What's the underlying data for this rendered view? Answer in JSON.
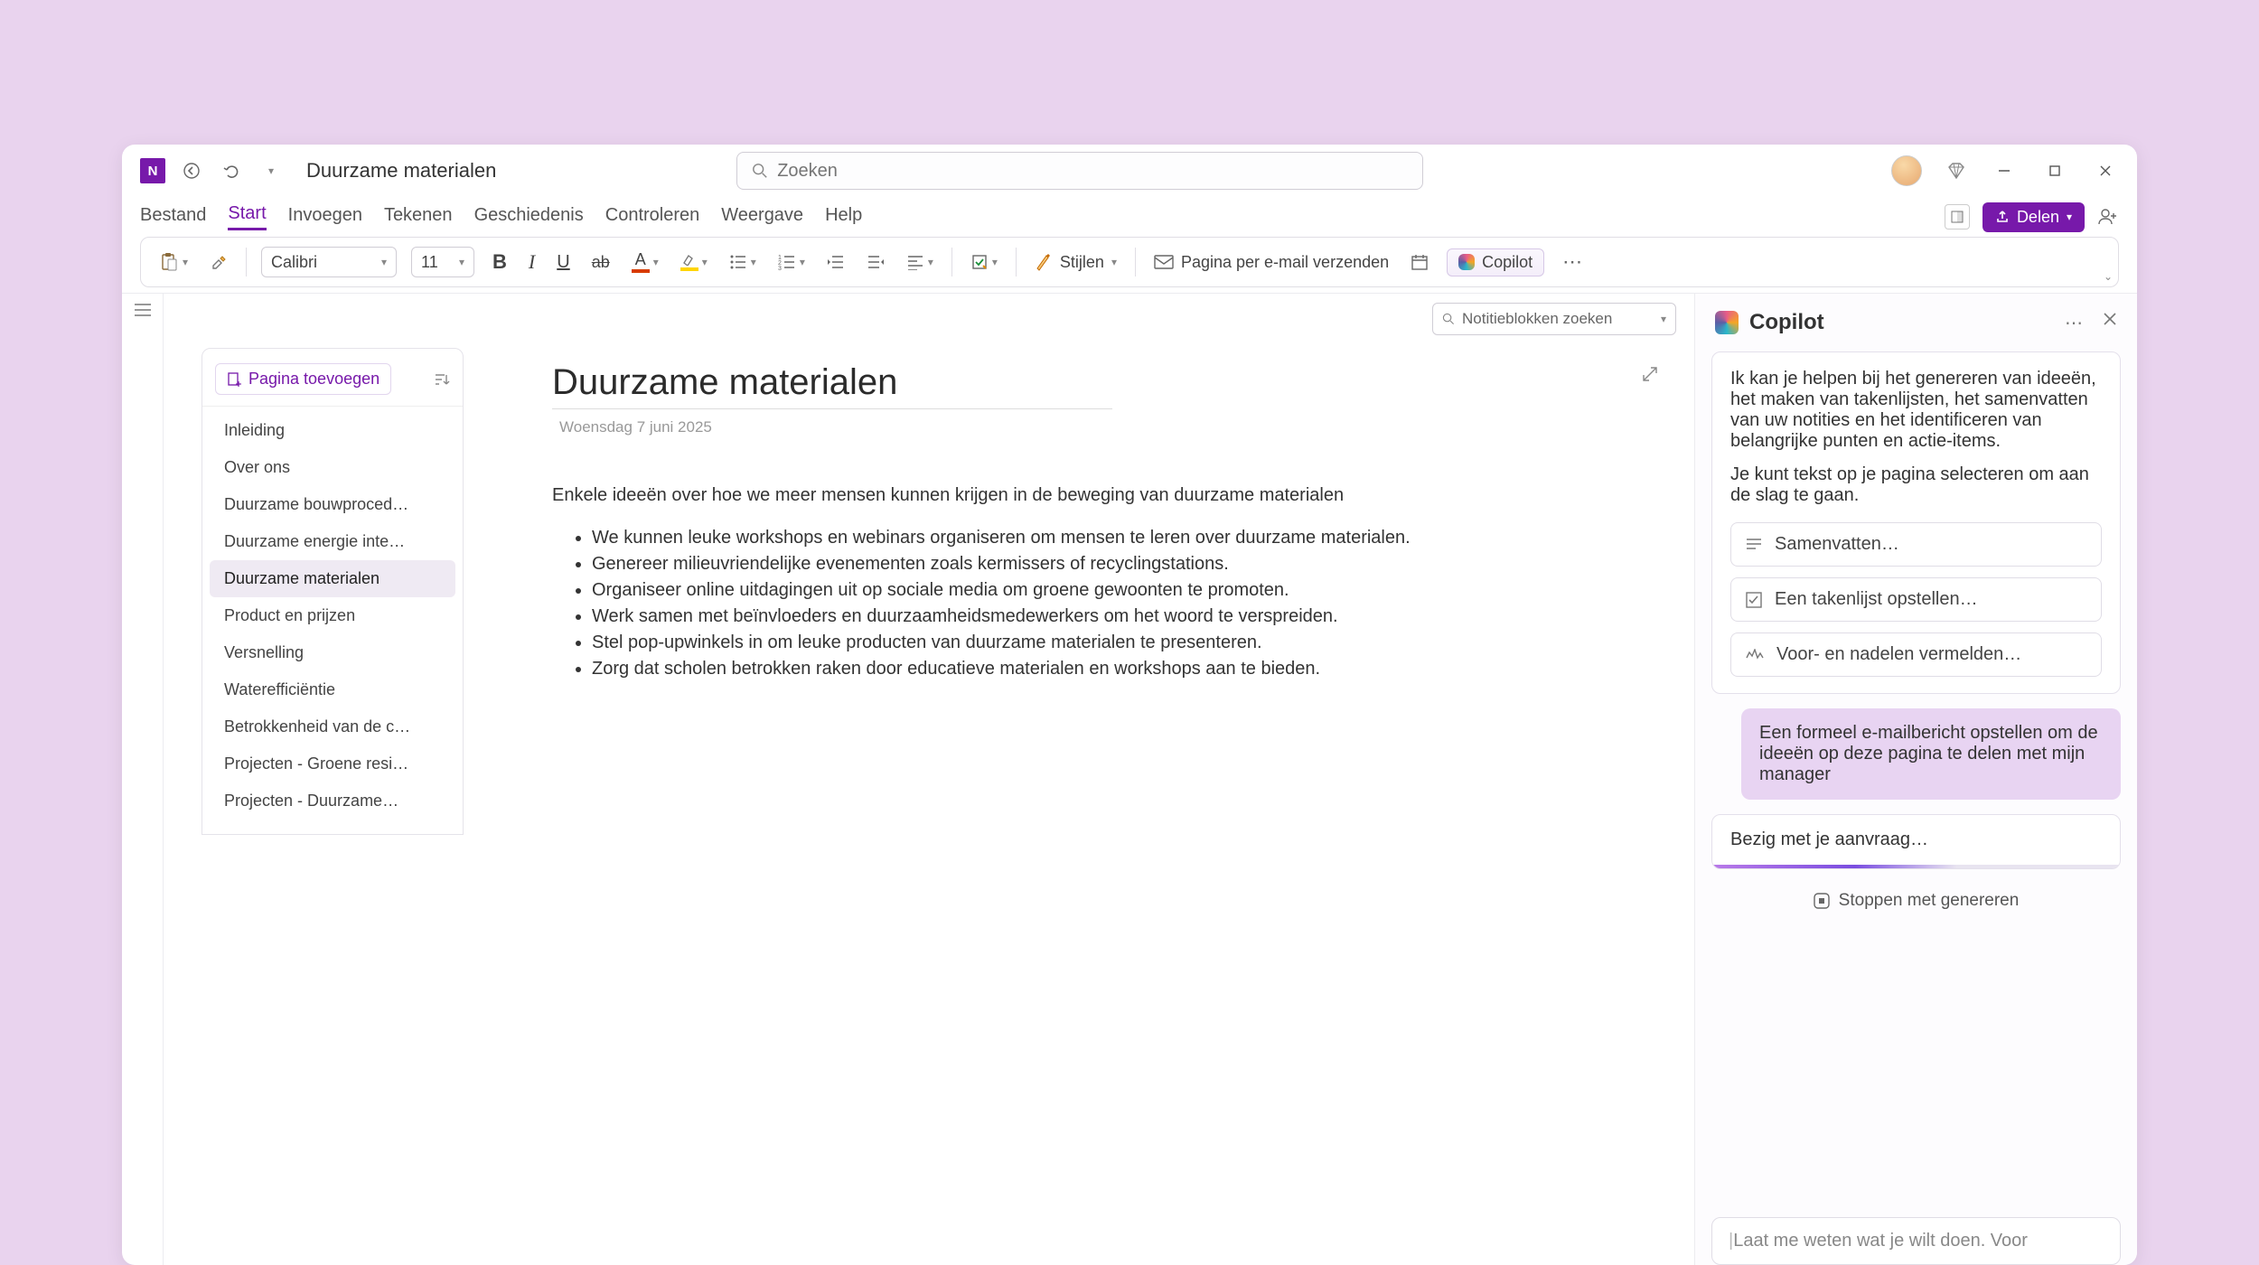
{
  "titlebar": {
    "doc_title": "Duurzame materialen",
    "search_placeholder": "Zoeken"
  },
  "ribbon": {
    "tabs": [
      "Bestand",
      "Start",
      "Invoegen",
      "Tekenen",
      "Geschiedenis",
      "Controleren",
      "Weergave",
      "Help"
    ],
    "active_index": 1,
    "share_label": "Delen"
  },
  "toolbar": {
    "font_name": "Calibri",
    "font_size": "11",
    "styles_label": "Stijlen",
    "email_page_label": "Pagina per e-mail verzenden",
    "copilot_label": "Copilot"
  },
  "notebook_search_placeholder": "Notitieblokken zoeken",
  "page_nav": {
    "add_page_label": "Pagina toevoegen",
    "items": [
      "Inleiding",
      "Over ons",
      "Duurzame bouwproced…",
      "Duurzame energie inte…",
      "Duurzame materialen",
      "Product en prijzen",
      "Versnelling",
      "Waterefficiëntie",
      "Betrokkenheid van de c…",
      "Projecten - Groene resi…",
      "Projecten - Duurzame…"
    ],
    "active_index": 4
  },
  "page": {
    "title": "Duurzame materialen",
    "date": "Woensdag 7 juni 2025",
    "intro": "Enkele ideeën over hoe we meer mensen kunnen krijgen in de beweging van duurzame materialen",
    "bullets": [
      "We kunnen leuke workshops en webinars organiseren om mensen te leren over duurzame materialen.",
      "Genereer milieuvriendelijke evenementen zoals kermissers of recyclingstations.",
      "Organiseer online uitdagingen uit op sociale media om groene gewoonten te promoten.",
      "Werk samen met beïnvloeders en duurzaamheidsmedewerkers om het woord te verspreiden.",
      "Stel pop-upwinkels in om leuke producten van duurzame materialen te presenteren.",
      "Zorg dat scholen betrokken raken door educatieve materialen en workshops aan te bieden."
    ]
  },
  "copilot": {
    "title": "Copilot",
    "greeting_1": "Ik kan je helpen bij het genereren van ideeën, het maken van takenlijsten, het samenvatten van uw notities en het identificeren van belangrijke punten en actie-items.",
    "greeting_2": "Je kunt tekst op je pagina selecteren om aan de slag te gaan.",
    "suggestions": [
      "Samenvatten…",
      "Een takenlijst opstellen…",
      "Voor- en nadelen vermelden…"
    ],
    "user_prompt": "Een formeel e-mailbericht opstellen om de ideeën op deze pagina te delen met mijn manager",
    "progress_label": "Bezig met je aanvraag…",
    "stop_label": "Stoppen met genereren",
    "input_placeholder": "Laat me weten wat je wilt doen. Voor"
  }
}
